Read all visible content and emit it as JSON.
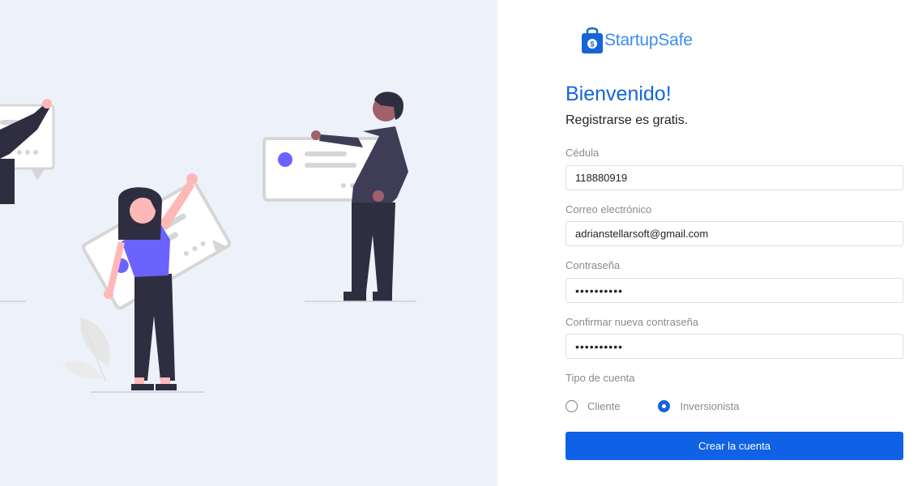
{
  "brand": {
    "name": "StartupSafe",
    "color": "#3d8bf2",
    "logo_icon": "shopping-bag-dollar-icon"
  },
  "heading": {
    "title": "Bienvenido!",
    "subtitle": "Registrarse es gratis."
  },
  "form": {
    "cedula": {
      "label": "Cédula",
      "value": "118880919"
    },
    "email": {
      "label": "Correo electrónico",
      "value": "adrianstellarsoft@gmail.com"
    },
    "password": {
      "label": "Contraseña",
      "value": "••••••••••"
    },
    "confirm_password": {
      "label": "Confirmar nueva contraseña",
      "value": "••••••••••"
    },
    "account_type": {
      "label": "Tipo de cuenta",
      "options": [
        {
          "label": "Cliente",
          "checked": false
        },
        {
          "label": "Inversionista",
          "checked": true
        }
      ]
    },
    "submit_label": "Crear la cuenta"
  },
  "colors": {
    "accent": "#1565d8",
    "button": "#0f62e6",
    "illustration_bg": "#edf1fa",
    "illustration_purple": "#6c63ff"
  }
}
